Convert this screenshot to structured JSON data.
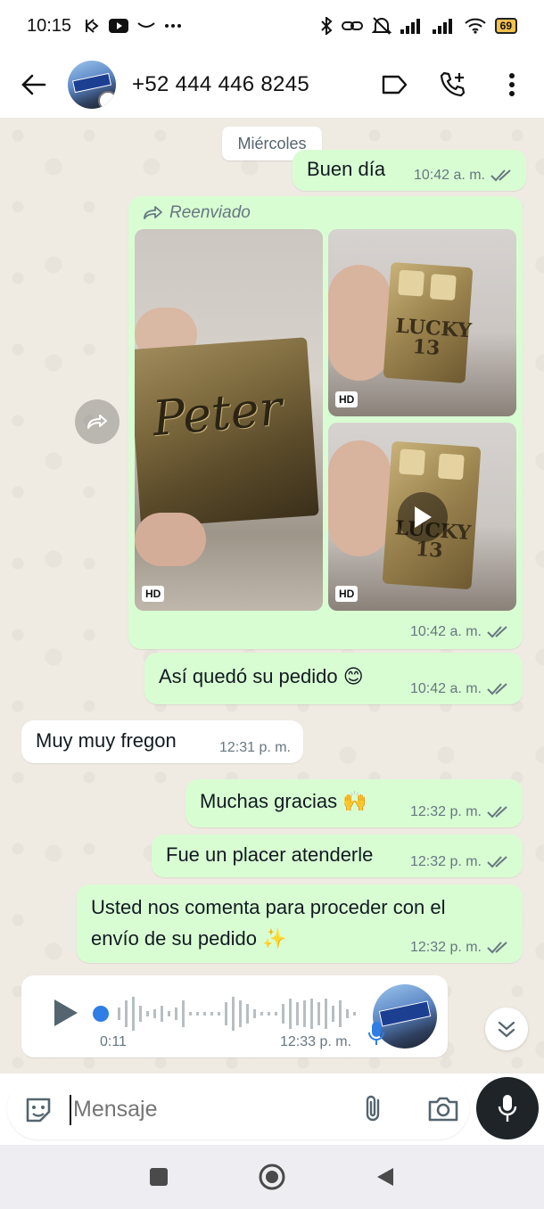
{
  "status_bar": {
    "time": "10:15",
    "battery": "69",
    "icons": [
      "k-icon",
      "youtube-icon",
      "smile-icon",
      "more-icon",
      "bluetooth-icon",
      "link-icon",
      "mute-icon",
      "signal-icon",
      "signal-icon",
      "wifi-icon",
      "battery-icon"
    ]
  },
  "header": {
    "contact": "+52 444 446 8245",
    "actions": [
      "label-icon",
      "call-add-icon",
      "more-vert-icon"
    ]
  },
  "chat": {
    "date_chip": "Miércoles",
    "messages": [
      {
        "text": "Buen día",
        "time": "10:42 a. m."
      },
      {
        "forward_label": "Reenviado",
        "time": "10:42 a. m.",
        "photo_1_text": "Peter",
        "photo_2_text_1": "LUCKY",
        "photo_2_text_2": "13",
        "photo_3_text_1": "LUCKY",
        "photo_3_text_2": "13",
        "hd": "HD"
      },
      {
        "text": "Así quedó su pedido 😊",
        "time": "10:42 a. m."
      },
      {
        "text": "Muy muy fregon",
        "time": "12:31 p. m."
      },
      {
        "text": "Muchas gracias 🙌",
        "time": "12:32 p. m."
      },
      {
        "text": "Fue un placer atenderle",
        "time": "12:32 p. m."
      },
      {
        "line1": "Usted nos comenta para proceder con el",
        "line2": "envío de su pedido ✨",
        "time": "12:32 p. m."
      }
    ],
    "voice": {
      "duration": "0:11",
      "time": "12:33 p. m."
    }
  },
  "input": {
    "placeholder": "Mensaje"
  },
  "colors": {
    "outgoing": "#d9fdd3",
    "incoming": "#ffffff",
    "chat_bg": "#efeae2",
    "tick": "#667781",
    "voice_dot": "#2e7ee5"
  }
}
